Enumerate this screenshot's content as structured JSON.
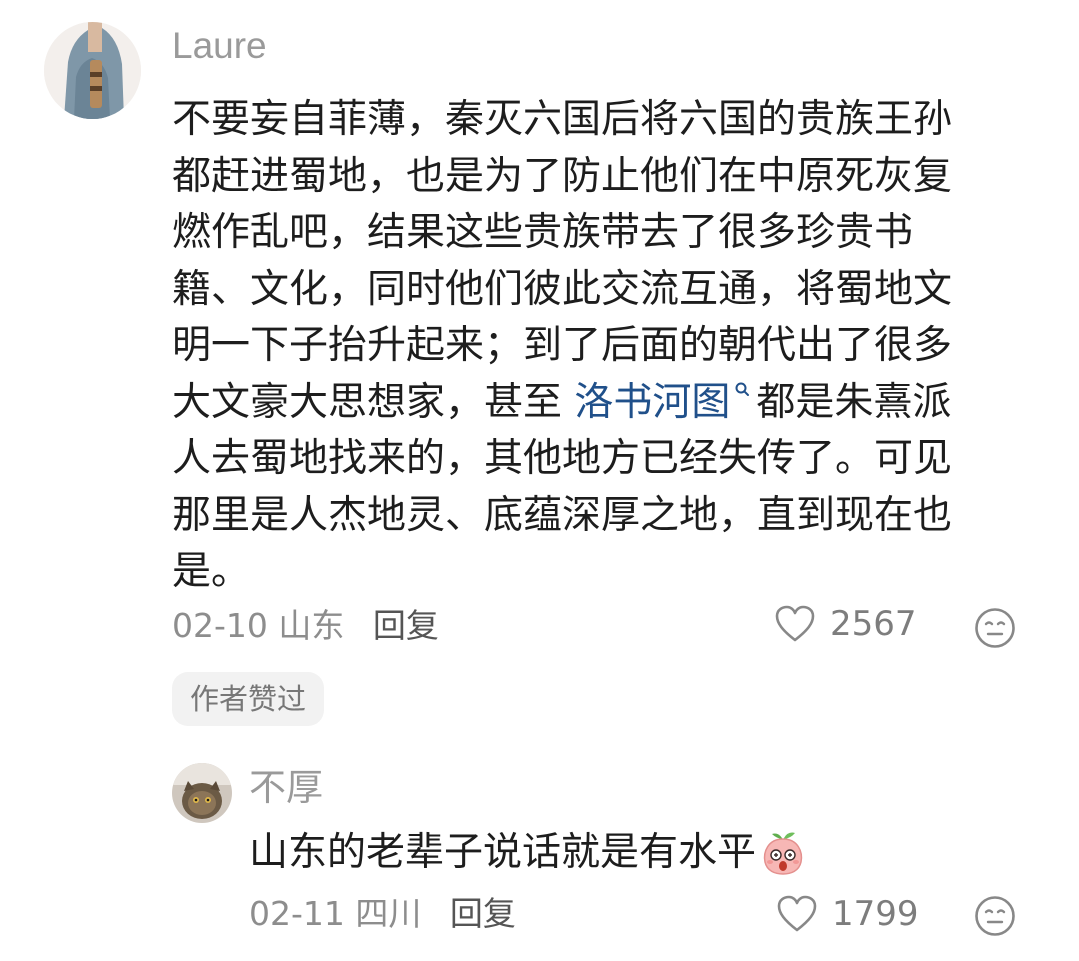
{
  "comment": {
    "username": "Laure",
    "avatar_icon": "user-avatar-photo",
    "lines_before_link": [
      "不要妄自菲薄，秦灭六国后将六国的贵族王孙",
      "都赶进蜀地，也是为了防止他们在中原死灰复",
      "燃作乱吧，结果这些贵族带去了很多珍贵书",
      "籍、文化，同时他们彼此交流互通，将蜀地文",
      "明一下子抬升起来；到了后面的朝代出了很多"
    ],
    "link_line_prefix": "大文豪大思想家，甚至 ",
    "link_text": "洛书河图",
    "link_icon": "search-icon",
    "link_line_suffix": "都是朱熹派",
    "lines_after_link": [
      "人去蜀地找来的，其他地方已经失传了。可见",
      "那里是人杰地灵、底蕴深厚之地，直到现在也",
      "是。"
    ],
    "date": "02-10",
    "location": "山东",
    "reply_label": "回复",
    "like_count": "2567",
    "like_icon": "heart-outline-icon",
    "react_icon": "neutral-face-icon",
    "author_badge": "作者赞过"
  },
  "reply": {
    "username": "不厚",
    "avatar_icon": "cat-avatar-photo",
    "text": "山东的老辈子说话就是有水平",
    "emoji_icon": "peach-surprised-emoji",
    "date": "02-11",
    "location": "四川",
    "reply_label": "回复",
    "like_count": "1799",
    "like_icon": "heart-outline-icon",
    "react_icon": "neutral-face-icon"
  },
  "colors": {
    "link": "#20508a",
    "meta_text": "#8d8d8d",
    "badge_bg": "#f2f2f2"
  }
}
